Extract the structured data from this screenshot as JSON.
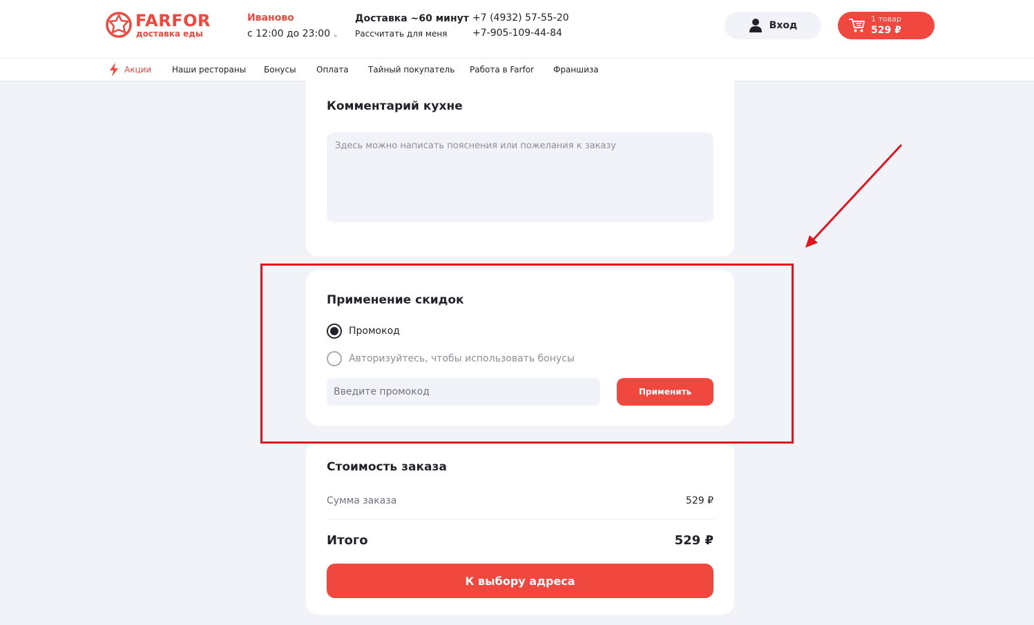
{
  "header": {
    "logo_name": "FARFOR",
    "logo_sub": "доставка еды",
    "city": "Иваново",
    "hours": "с 12:00 до 23:00",
    "delivery_title": "Доставка ~60 минут",
    "delivery_calc": "Рассчитать для меня",
    "phone1": "+7 (4932) 57-55-20",
    "phone2": "+7-905-109-44-84",
    "login_label": "Вход",
    "cart_count": "1 товар",
    "cart_sum": "529 ₽"
  },
  "nav": {
    "items": [
      "Акции",
      "Наши рестораны",
      "Бонусы",
      "Оплата",
      "Тайный покупатель",
      "Работа в Farfor",
      "Франшиза"
    ]
  },
  "comment": {
    "title": "Комментарий кухне",
    "placeholder": "Здесь можно написать пояснения или пожелания к заказу"
  },
  "discount": {
    "title": "Применение скидок",
    "option_promo": "Промокод",
    "option_bonus": "Авторизуйтесь, чтобы использовать бонусы",
    "promo_placeholder": "Введите промокод",
    "apply_label": "Применить"
  },
  "cost": {
    "title": "Стоимость заказа",
    "sum_label": "Сумма заказа",
    "sum_value": "529 ₽",
    "total_label": "Итого",
    "total_value": "529 ₽",
    "next_label": "К выбору адреса"
  },
  "colors": {
    "accent": "#f0483e",
    "background": "#f1f3f8",
    "annotation": "#e0141c"
  },
  "icons": {
    "logo": "farfor-logo-icon",
    "user": "user-icon",
    "cart": "cart-icon",
    "promo": "lightning-icon"
  }
}
